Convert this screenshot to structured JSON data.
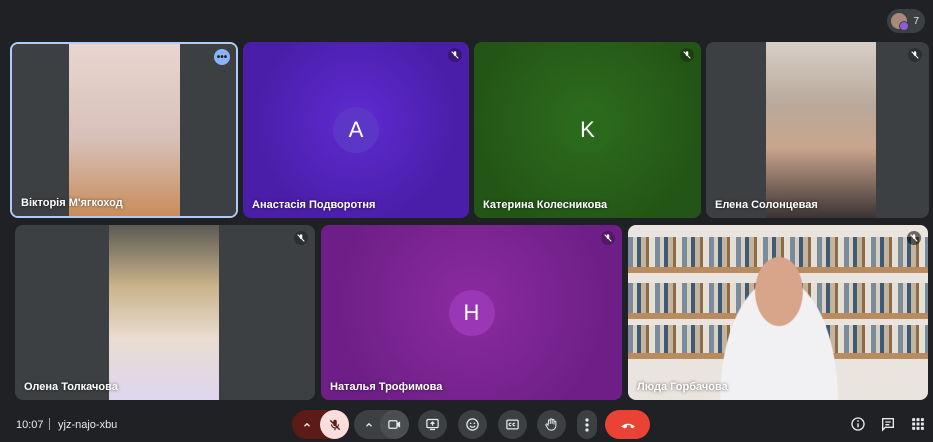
{
  "participants_count": "7",
  "tiles": [
    {
      "name": "Вікторія М'ягкоход"
    },
    {
      "name": "Анастасія Подворотня",
      "initial": "A"
    },
    {
      "name": "Катерина Колесникова",
      "initial": "K"
    },
    {
      "name": "Елена Солонцевая"
    },
    {
      "name": "Олена Толкачова"
    },
    {
      "name": "Наталья Трофимова",
      "initial": "H"
    },
    {
      "name": "Люда Горбачова"
    }
  ],
  "bottom_bar": {
    "time": "10:07",
    "meeting_code": "yjz-najo-xbu"
  },
  "colors": {
    "background": "#202124",
    "active_speaker_border": "#aecbfa",
    "end_call": "#ea4335",
    "mic_off": "#f9dedc"
  },
  "icons": [
    "people-icon",
    "more-options-icon",
    "mic-off-icon",
    "chevron-up-icon",
    "camera-icon",
    "present-icon",
    "emoji-icon",
    "captions-icon",
    "raise-hand-icon",
    "more-vert-icon",
    "end-call-icon",
    "info-icon",
    "chat-icon",
    "apps-icon"
  ]
}
